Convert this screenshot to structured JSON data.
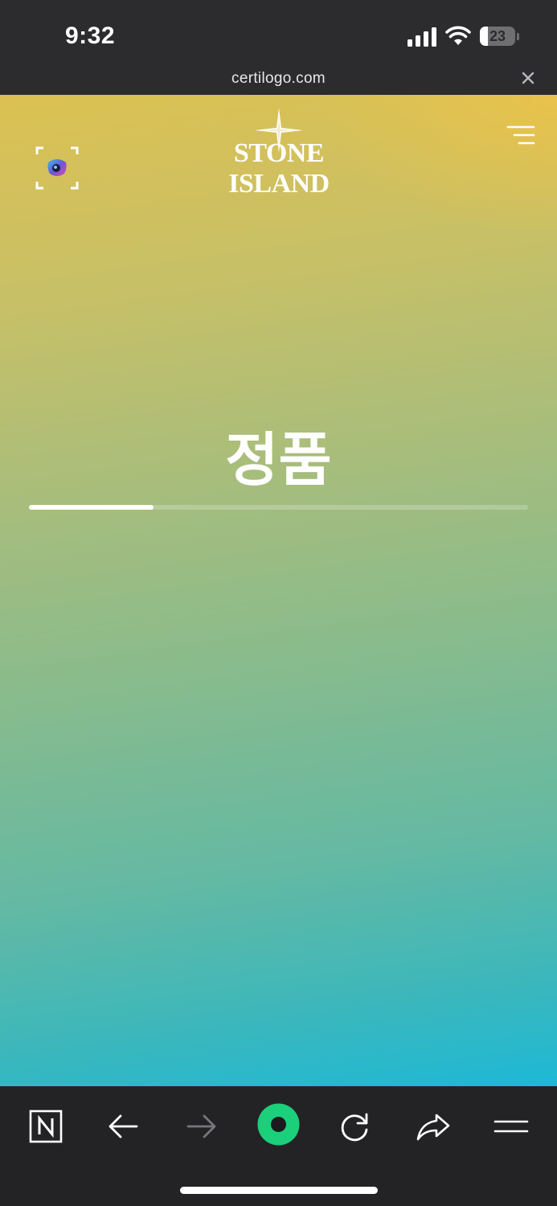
{
  "status_bar": {
    "time": "9:32",
    "battery_level": "23",
    "battery_percent": 0.23
  },
  "browser": {
    "url": "certilogo.com",
    "close_icon": "close-icon"
  },
  "page": {
    "brand_logo_text": "STONE ISLAND",
    "result_text": "정품",
    "progress": 0.25,
    "scan_icon": "scan-qr-icon",
    "menu_icon": "hamburger-menu-icon",
    "gradient_colors": [
      "#dcc152",
      "#a5bd7d",
      "#64b9a3",
      "#1db8d6"
    ]
  },
  "toolbar": {
    "items": [
      {
        "name": "notion-icon"
      },
      {
        "name": "back-arrow-icon"
      },
      {
        "name": "forward-arrow-icon",
        "disabled": true
      },
      {
        "name": "app-home-icon",
        "color": "#1ccf7a"
      },
      {
        "name": "reload-icon"
      },
      {
        "name": "share-icon"
      },
      {
        "name": "menu-icon"
      }
    ]
  }
}
